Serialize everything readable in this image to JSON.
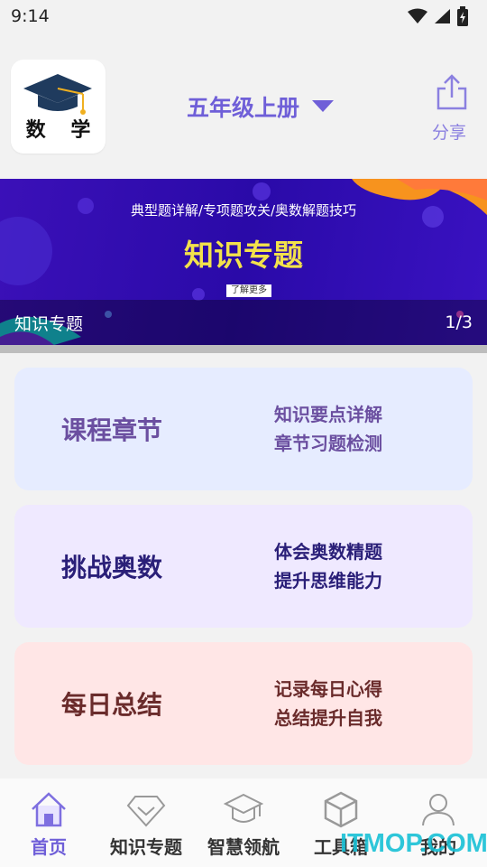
{
  "status_bar": {
    "time": "9:14"
  },
  "header": {
    "logo_text": "数 学",
    "grade_label": "五年级上册",
    "share_label": "分享"
  },
  "banner": {
    "subtitle": "典型题详解/专项题攻关/奥数解题技巧",
    "title": "知识专题",
    "more_label": "了解更多",
    "caption": "知识专题",
    "counter": "1/3"
  },
  "cards": [
    {
      "title": "课程章节",
      "line1": "知识要点详解",
      "line2": "章节习题检测"
    },
    {
      "title": "挑战奥数",
      "line1": "体会奥数精题",
      "line2": "提升思维能力"
    },
    {
      "title": "每日总结",
      "line1": "记录每日心得",
      "line2": "总结提升自我"
    }
  ],
  "nav": {
    "items": [
      {
        "label": "首页",
        "icon": "home-icon"
      },
      {
        "label": "知识专题",
        "icon": "diamond-icon"
      },
      {
        "label": "智慧领航",
        "icon": "graduation-cap-icon"
      },
      {
        "label": "工具箱",
        "icon": "cube-icon"
      },
      {
        "label": "我的",
        "icon": "user-icon"
      }
    ]
  },
  "watermark": "ITMOP.COM",
  "colors": {
    "accent": "#6f5fd8",
    "card1_bg": "#e6ecff",
    "card2_bg": "#efe9ff",
    "card3_bg": "#ffe6e6",
    "banner_title": "#f3e24b"
  }
}
